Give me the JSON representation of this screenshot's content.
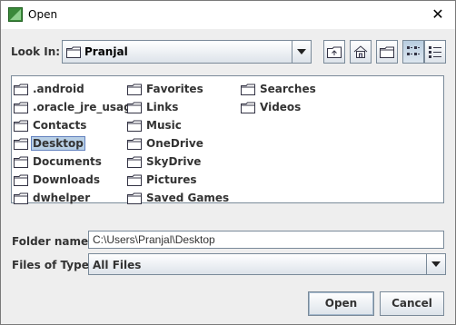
{
  "window": {
    "title": "Open",
    "close_glyph": "✕"
  },
  "look_in": {
    "label": "Look In:",
    "value": "Pranjal"
  },
  "toolbar": {
    "icons": [
      "up-folder-icon",
      "home-icon",
      "new-folder-icon",
      "list-view-icon",
      "details-view-icon"
    ]
  },
  "files": {
    "col1": [
      {
        "name": ".android"
      },
      {
        "name": ".oracle_jre_usage"
      },
      {
        "name": "Contacts"
      },
      {
        "name": "Desktop",
        "selected": true
      },
      {
        "name": "Documents"
      },
      {
        "name": "Downloads"
      },
      {
        "name": "dwhelper"
      }
    ],
    "col2": [
      {
        "name": "Favorites"
      },
      {
        "name": "Links"
      },
      {
        "name": "Music"
      },
      {
        "name": "OneDrive"
      },
      {
        "name": "SkyDrive"
      },
      {
        "name": "Pictures"
      },
      {
        "name": "Saved Games"
      }
    ],
    "col3": [
      {
        "name": "Searches"
      },
      {
        "name": "Videos"
      }
    ]
  },
  "folder_name": {
    "label": "Folder name:",
    "value": "C:\\Users\\Pranjal\\Desktop"
  },
  "files_of_type": {
    "label": "Files of Type:",
    "value": "All Files"
  },
  "buttons": {
    "open": "Open",
    "cancel": "Cancel"
  },
  "colors": {
    "selection": "#b8cfe5",
    "border": "#7a8a99",
    "dialog_bg": "#eeeeee"
  }
}
